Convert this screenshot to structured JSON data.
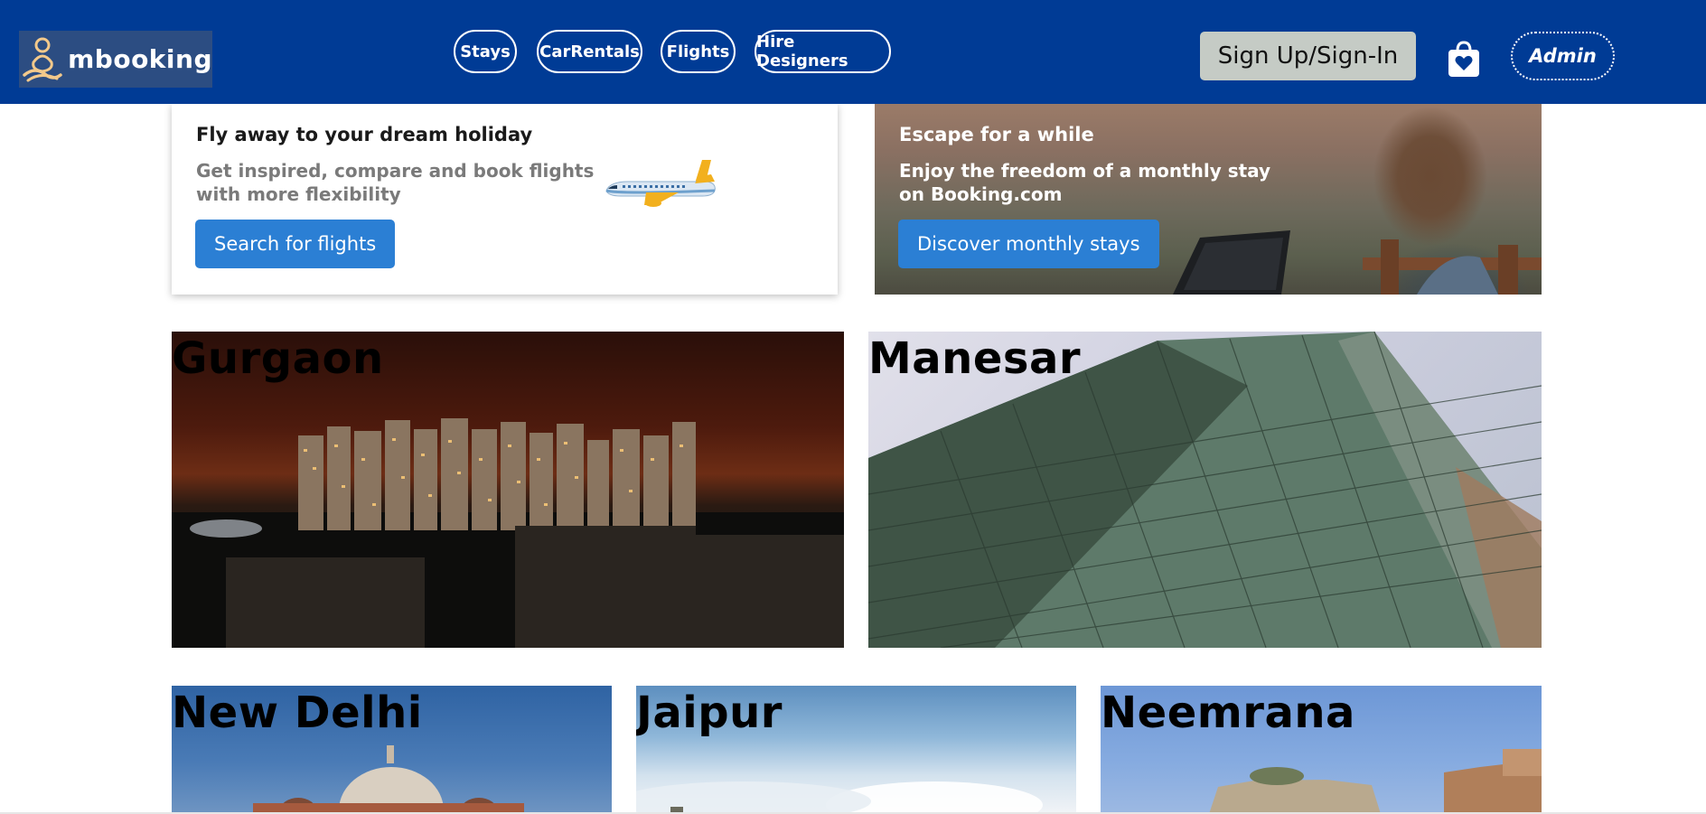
{
  "brand": {
    "name": "mbooking"
  },
  "nav": {
    "links": [
      "Stays",
      "CarRentals",
      "Flights",
      "Hire Designers"
    ],
    "signin_label": "Sign Up/Sign-In",
    "admin_label": "Admin"
  },
  "promo": {
    "flights": {
      "title": "Fly away to your dream holiday",
      "subtitle": "Get inspired, compare and book flights with more flexibility",
      "button": "Search for flights"
    },
    "monthly": {
      "title": "Escape for a while",
      "subtitle": "Enjoy the freedom of a monthly stay on Booking.com",
      "button": "Discover monthly stays"
    }
  },
  "cities": [
    "Gurgaon",
    "Manesar",
    "New Delhi",
    "Jaipur",
    "Neemrana"
  ],
  "colors": {
    "navbar": "#003b95",
    "primary_button": "#2b7fd4",
    "signin_button": "#c5cbc5"
  },
  "icons": [
    "logo-meditation-icon",
    "shopping-bag-heart-icon",
    "airplane-illustration"
  ]
}
